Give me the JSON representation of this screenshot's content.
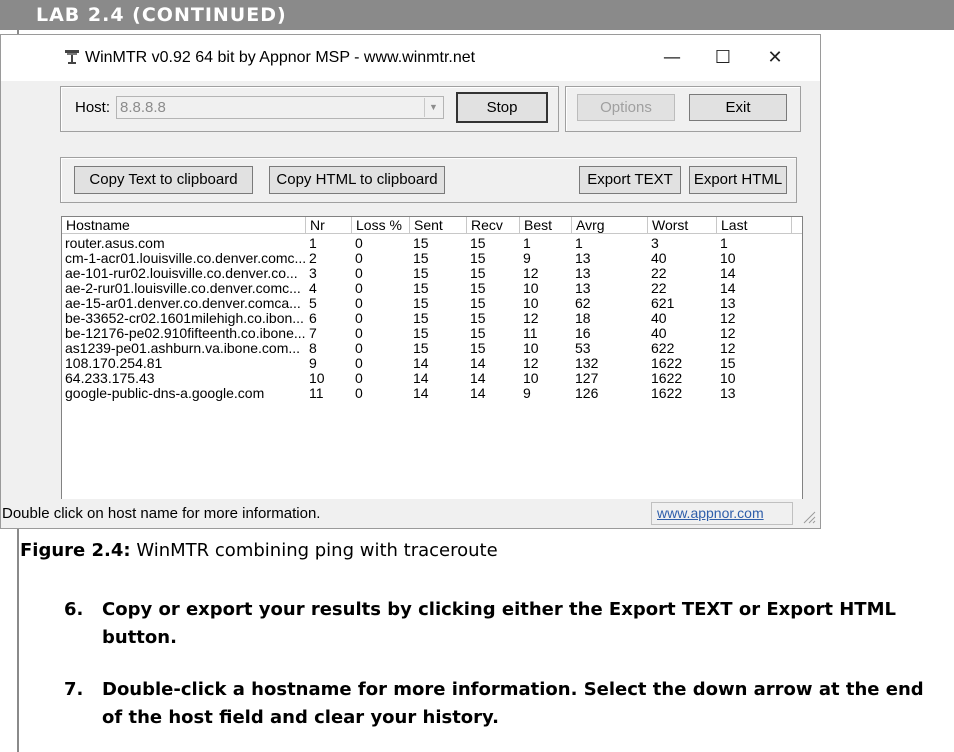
{
  "lab_header": "LAB 2.4 (CONTINUED)",
  "window": {
    "title": "WinMTR v0.92 64 bit by Appnor MSP - www.winmtr.net",
    "minimize_glyph": "—",
    "maximize_glyph": "☐",
    "close_glyph": "✕"
  },
  "host": {
    "label": "Host:",
    "value": "8.8.8.8",
    "stop_label": "Stop"
  },
  "options_label": "Options",
  "exit_label": "Exit",
  "copy_text_label": "Copy Text to clipboard",
  "copy_html_label": "Copy HTML to clipboard",
  "export_text_label": "Export TEXT",
  "export_html_label": "Export HTML",
  "columns": [
    "Hostname",
    "Nr",
    "Loss %",
    "Sent",
    "Recv",
    "Best",
    "Avrg",
    "Worst",
    "Last"
  ],
  "rows": [
    [
      "router.asus.com",
      "1",
      "0",
      "15",
      "15",
      "1",
      "1",
      "3",
      "1"
    ],
    [
      "cm-1-acr01.louisville.co.denver.comc...",
      "2",
      "0",
      "15",
      "15",
      "9",
      "13",
      "40",
      "10"
    ],
    [
      "ae-101-rur02.louisville.co.denver.co...",
      "3",
      "0",
      "15",
      "15",
      "12",
      "13",
      "22",
      "14"
    ],
    [
      "ae-2-rur01.louisville.co.denver.comc...",
      "4",
      "0",
      "15",
      "15",
      "10",
      "13",
      "22",
      "14"
    ],
    [
      "ae-15-ar01.denver.co.denver.comca...",
      "5",
      "0",
      "15",
      "15",
      "10",
      "62",
      "621",
      "13"
    ],
    [
      "be-33652-cr02.1601milehigh.co.ibon...",
      "6",
      "0",
      "15",
      "15",
      "12",
      "18",
      "40",
      "12"
    ],
    [
      "be-12176-pe02.910fifteenth.co.ibone...",
      "7",
      "0",
      "15",
      "15",
      "11",
      "16",
      "40",
      "12"
    ],
    [
      "as1239-pe01.ashburn.va.ibone.com...",
      "8",
      "0",
      "15",
      "15",
      "10",
      "53",
      "622",
      "12"
    ],
    [
      "108.170.254.81",
      "9",
      "0",
      "14",
      "14",
      "12",
      "132",
      "1622",
      "15"
    ],
    [
      "64.233.175.43",
      "10",
      "0",
      "14",
      "14",
      "10",
      "127",
      "1622",
      "10"
    ],
    [
      "google-public-dns-a.google.com",
      "11",
      "0",
      "14",
      "14",
      "9",
      "126",
      "1622",
      "13"
    ]
  ],
  "status": {
    "text": "Double click on host name for more information.",
    "link": "www.appnor.com"
  },
  "caption": {
    "label": "Figure 2.4:",
    "text": "WinMTR combining ping with traceroute"
  },
  "steps": [
    {
      "num": "6.",
      "text": "Copy or export your results by clicking either the Export TEXT or Export HTML button."
    },
    {
      "num": "7.",
      "text": "Double-click a hostname for more information. Select the down arrow at the end of the host field and clear your history."
    }
  ],
  "icons": {
    "app": "network-tower-icon",
    "combo_arrow": "chevron-down-icon",
    "resize_grip": "resize-grip-icon"
  }
}
